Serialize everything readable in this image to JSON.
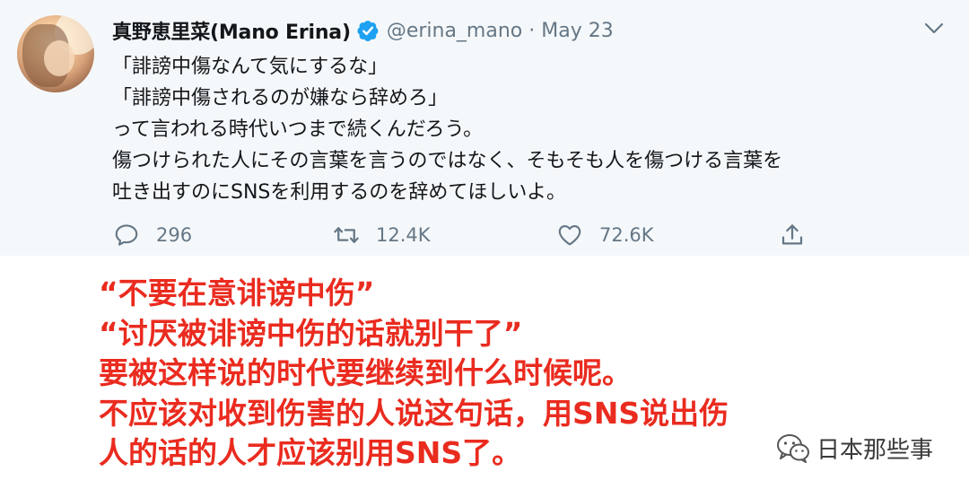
{
  "tweet": {
    "display_name": "真野恵里菜(Mano Erina)",
    "handle": "@erina_mano",
    "separator": "·",
    "date": "May 23",
    "verified": true,
    "lines": [
      "「誹謗中傷なんて気にするな」",
      "「誹謗中傷されるのが嫌なら辞めろ」",
      "って言われる時代いつまで続くんだろう。",
      "傷つけられた人にその言葉を言うのではなく、そもそも人を傷つける言葉を",
      "吐き出すのにSNSを利用するのを辞めてほしいよ。"
    ],
    "actions": {
      "reply_count": "296",
      "retweet_count": "12.4K",
      "like_count": "72.6K"
    },
    "icons": {
      "verified": "verified-badge-icon",
      "menu": "chevron-down-icon",
      "reply": "reply-icon",
      "retweet": "retweet-icon",
      "like": "heart-icon",
      "share": "share-icon"
    }
  },
  "translation": {
    "lines": [
      "“不要在意诽谤中伤”",
      "“讨厌被诽谤中伤的话就别干了”",
      "要被这样说的时代要继续到什么时候呢。",
      "不应该对收到伤害的人说这句话，用SNS说出伤",
      "人的话的人才应该别用SNS了。"
    ]
  },
  "watermark": {
    "text": "日本那些事",
    "icon": "wechat-icon"
  },
  "colors": {
    "card_background": "#f5f8fa",
    "text_primary": "#14171a",
    "text_secondary": "#657786",
    "verified_blue": "#1da1f2",
    "translation_red": "#ea2b1f"
  }
}
